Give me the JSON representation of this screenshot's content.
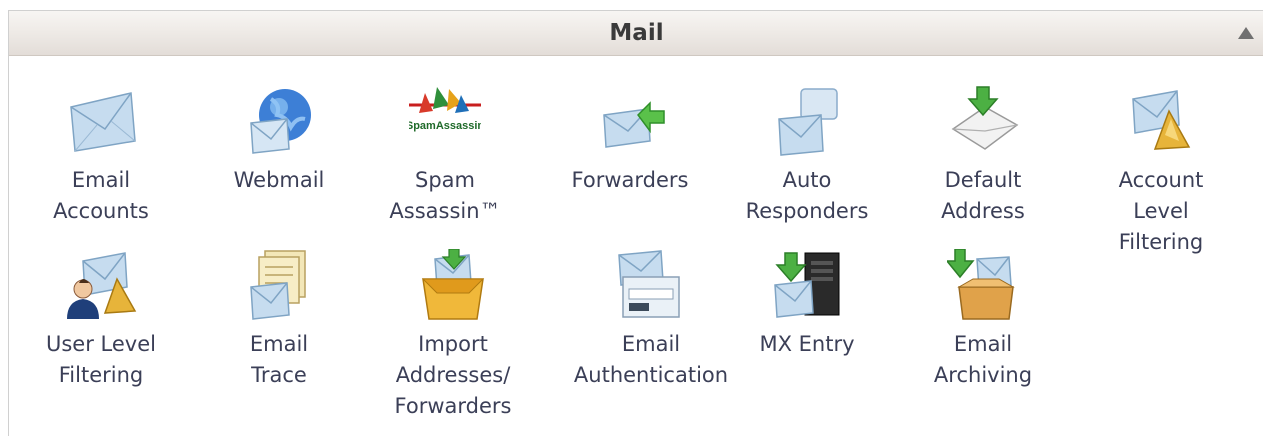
{
  "panel": {
    "title": "Mail",
    "collapse_icon": "triangle-up-icon"
  },
  "items": [
    {
      "label": "Email\nAccounts",
      "icon": "email-accounts-icon"
    },
    {
      "label": "Webmail",
      "icon": "webmail-icon"
    },
    {
      "label": "Spam\nAssassin™",
      "icon": "spamassassin-icon",
      "logo_text": "SpamAssassin"
    },
    {
      "label": "Forwarders",
      "icon": "forwarders-icon"
    },
    {
      "label": "Auto\nResponders",
      "icon": "auto-responders-icon"
    },
    {
      "label": "Default\nAddress",
      "icon": "default-address-icon"
    },
    {
      "label": "Account\nLevel\nFiltering",
      "icon": "account-filtering-icon"
    },
    {
      "label": "User Level\nFiltering",
      "icon": "user-filtering-icon"
    },
    {
      "label": "Email\nTrace",
      "icon": "email-trace-icon"
    },
    {
      "label": "Import\nAddresses/\nForwarders",
      "icon": "import-icon"
    },
    {
      "label": "Email\nAuthentication",
      "icon": "email-authentication-icon"
    },
    {
      "label": "MX Entry",
      "icon": "mx-entry-icon"
    },
    {
      "label": "Email\nArchiving",
      "icon": "email-archiving-icon"
    }
  ],
  "colors": {
    "label_text": "#3b3f57",
    "header_bg": "#efebe7",
    "envelope": "#b9d3ea",
    "arrow_green": "#3fae3a"
  }
}
